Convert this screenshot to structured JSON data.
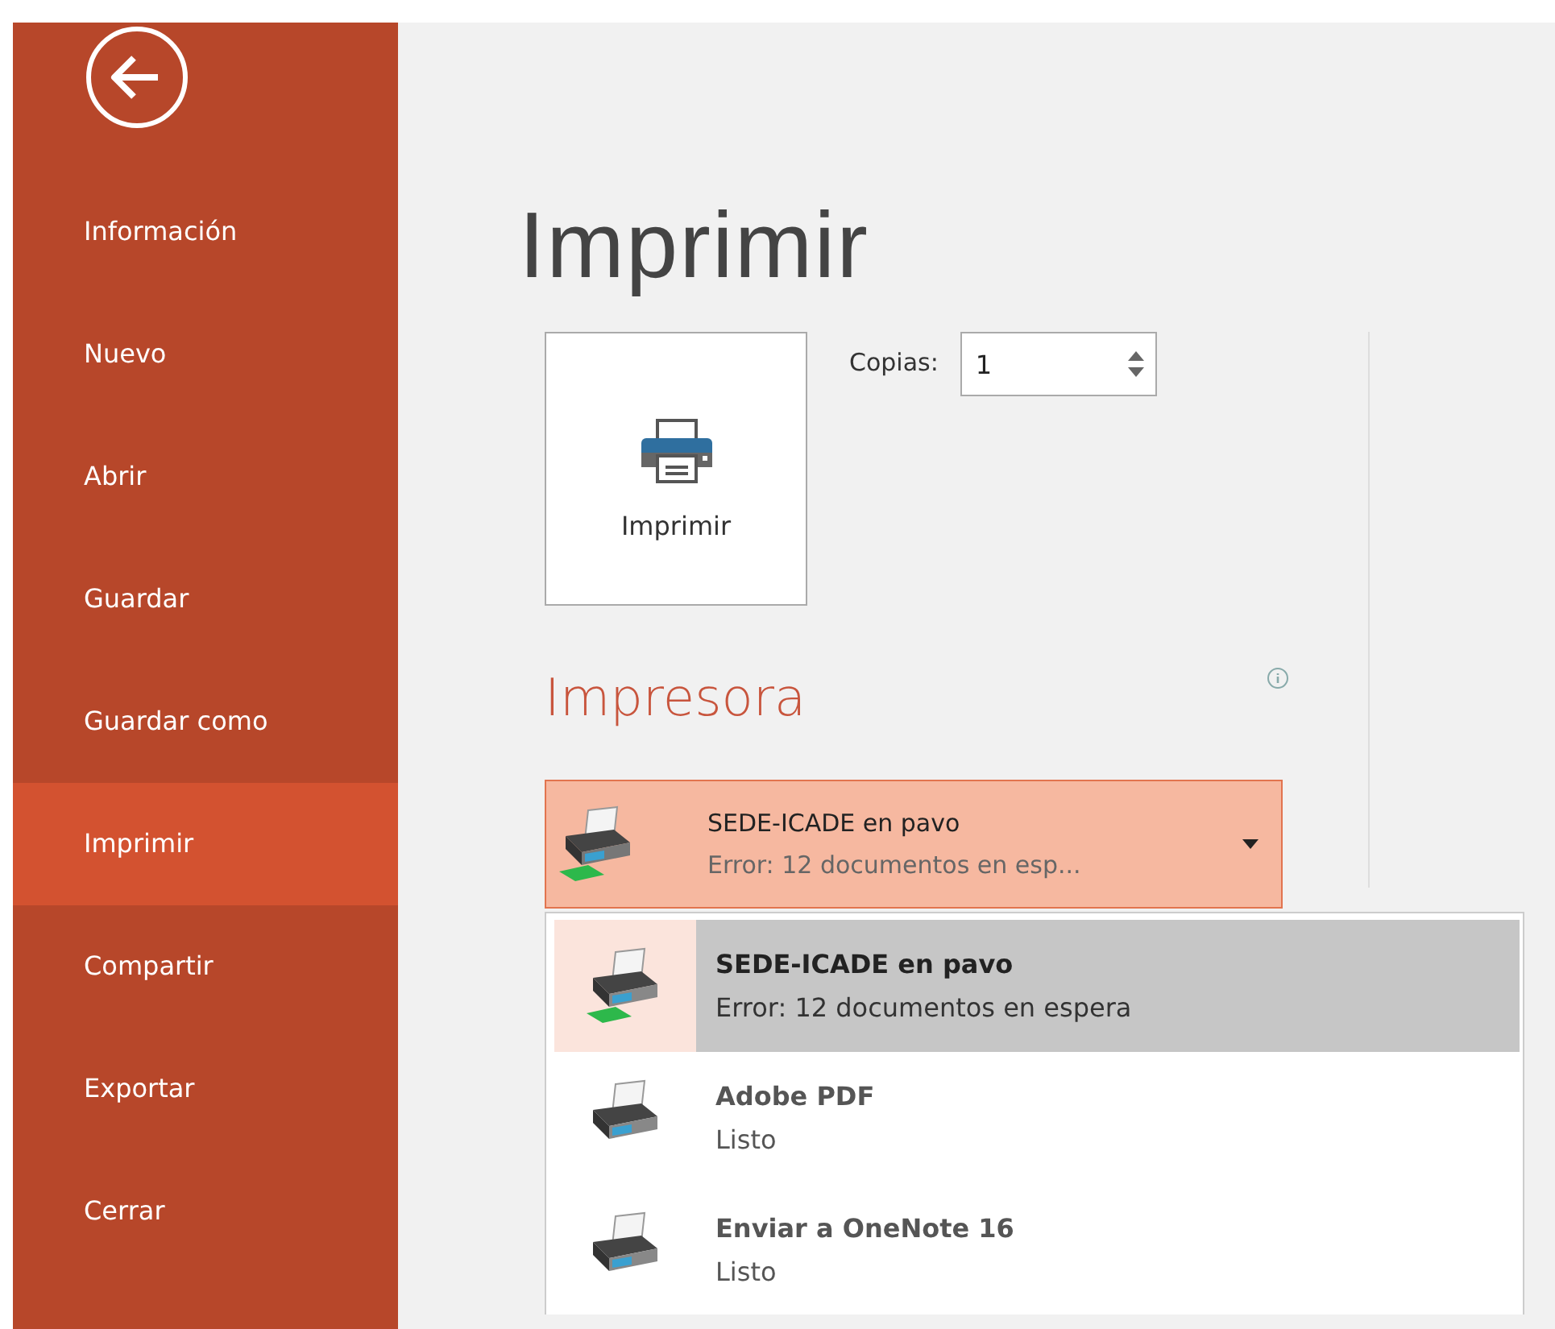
{
  "sidebar": {
    "items": [
      {
        "label": "Información",
        "selected": false
      },
      {
        "label": "Nuevo",
        "selected": false
      },
      {
        "label": "Abrir",
        "selected": false
      },
      {
        "label": "Guardar",
        "selected": false
      },
      {
        "label": "Guardar como",
        "selected": false
      },
      {
        "label": "Imprimir",
        "selected": true
      },
      {
        "label": "Compartir",
        "selected": false
      },
      {
        "label": "Exportar",
        "selected": false
      },
      {
        "label": "Cerrar",
        "selected": false
      }
    ]
  },
  "title": "Imprimir",
  "print_button": {
    "label": "Imprimir"
  },
  "copies": {
    "label": "Copias:",
    "value": "1"
  },
  "printer_section": {
    "title": "Impresora",
    "current": {
      "name": "SEDE-ICADE en pavo",
      "status": "Error: 12 documentos en esp...",
      "network": true
    },
    "options": [
      {
        "name": "SEDE-ICADE en pavo",
        "status": "Error: 12 documentos en espera",
        "network": true,
        "selected": true
      },
      {
        "name": "Adobe PDF",
        "status": "Listo",
        "network": false,
        "selected": false
      },
      {
        "name": "Enviar a OneNote 16",
        "status": "Listo",
        "network": false,
        "selected": false
      }
    ]
  }
}
